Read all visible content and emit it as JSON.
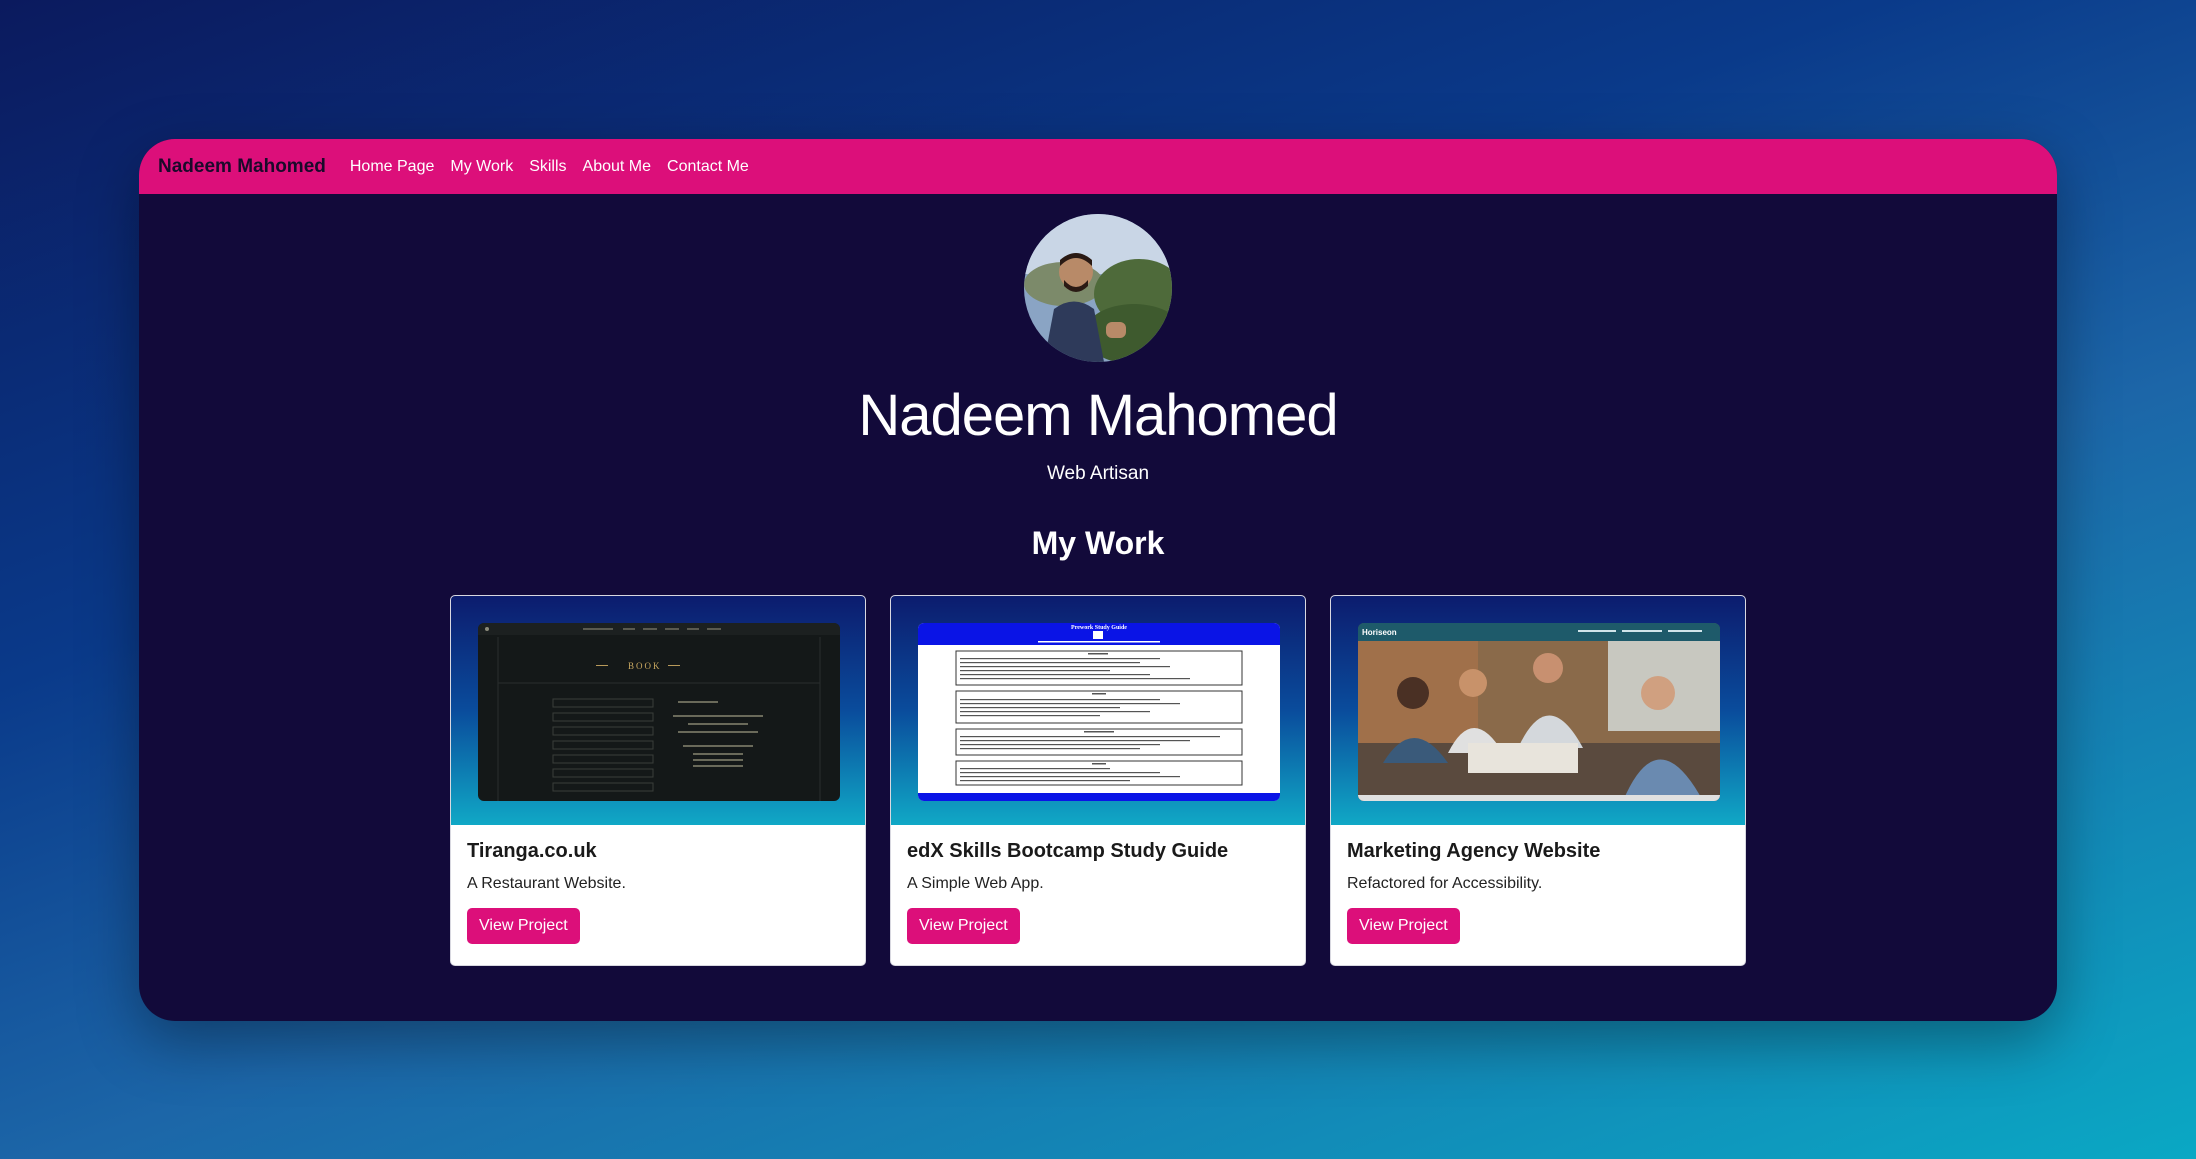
{
  "nav": {
    "brand": "Nadeem Mahomed",
    "links": [
      "Home Page",
      "My Work",
      "Skills",
      "About Me",
      "Contact Me"
    ]
  },
  "hero": {
    "name": "Nadeem Mahomed",
    "tagline": "Web Artisan"
  },
  "work": {
    "title": "My Work",
    "projects": [
      {
        "title": "Tiranga.co.uk",
        "description": "A Restaurant Website.",
        "button": "View Project",
        "shot_logo": "BOOK"
      },
      {
        "title": "edX Skills Bootcamp Study Guide",
        "description": "A Simple Web App.",
        "button": "View Project",
        "shot_heading": "Prework Study Guide"
      },
      {
        "title": "Marketing Agency Website",
        "description": "Refactored for Accessibility.",
        "button": "View Project",
        "shot_logo": "Horiseon"
      }
    ]
  },
  "colors": {
    "accent": "#dc0f7a",
    "window_bg": "#120a3a"
  }
}
